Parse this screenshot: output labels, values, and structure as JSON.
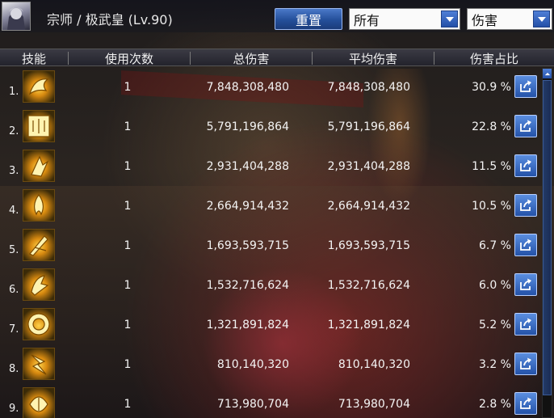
{
  "header": {
    "title": "宗师 / 极武皇 (Lv.90)",
    "reset_label": "重置",
    "filter_select": {
      "selected": "所有"
    },
    "metric_select": {
      "selected": "伤害"
    }
  },
  "table": {
    "columns": [
      "技能",
      "使用次数",
      "总伤害",
      "平均伤害",
      "伤害占比"
    ],
    "rows": [
      {
        "rank": "1.",
        "uses": "1",
        "total": "7,848,308,480",
        "average": "7,848,308,480",
        "share": "30.9 %"
      },
      {
        "rank": "2.",
        "uses": "1",
        "total": "5,791,196,864",
        "average": "5,791,196,864",
        "share": "22.8 %"
      },
      {
        "rank": "3.",
        "uses": "1",
        "total": "2,931,404,288",
        "average": "2,931,404,288",
        "share": "11.5 %"
      },
      {
        "rank": "4.",
        "uses": "1",
        "total": "2,664,914,432",
        "average": "2,664,914,432",
        "share": "10.5 %"
      },
      {
        "rank": "5.",
        "uses": "1",
        "total": "1,693,593,715",
        "average": "1,693,593,715",
        "share": "6.7 %"
      },
      {
        "rank": "6.",
        "uses": "1",
        "total": "1,532,716,624",
        "average": "1,532,716,624",
        "share": "6.0 %"
      },
      {
        "rank": "7.",
        "uses": "1",
        "total": "1,321,891,824",
        "average": "1,321,891,824",
        "share": "5.2 %"
      },
      {
        "rank": "8.",
        "uses": "1",
        "total": "810,140,320",
        "average": "810,140,320",
        "share": "3.2 %"
      },
      {
        "rank": "9.",
        "uses": "1",
        "total": "713,980,704",
        "average": "713,980,704",
        "share": "2.8 %"
      }
    ]
  },
  "icons": {
    "avatar": "character-portrait-icon",
    "select_arrow": "chevron-down-icon",
    "share": "share-export-icon",
    "skill": "skill-icon",
    "scroll_up": "scroll-up-icon"
  },
  "colors": {
    "accent_blue": "#2f5fb8",
    "skill_gold": "#e8a21a",
    "text": "#f4f4f4"
  }
}
